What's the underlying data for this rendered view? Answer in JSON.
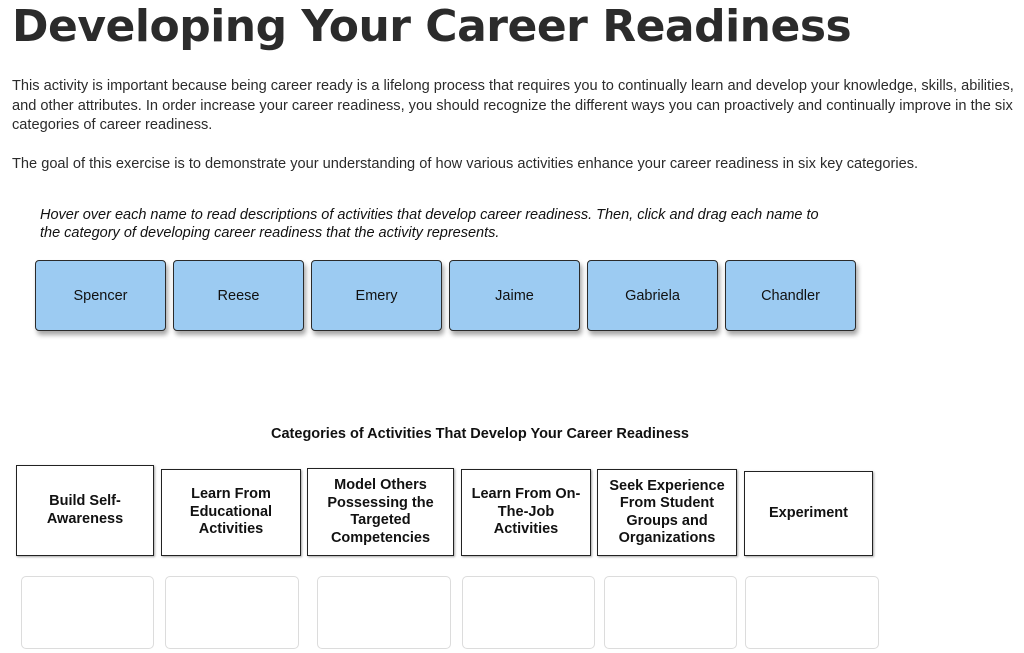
{
  "page": {
    "title": "Developing Your Career Readiness",
    "paragraphs": [
      "This activity is important because being career ready is a lifelong process that requires you to continually learn and develop your knowledge, skills, abilities, and other attributes. In order increase your career readiness, you should recognize the different ways you can proactively and continually improve in the six categories of career readiness.",
      "The goal of this exercise is to demonstrate your understanding of how various activities enhance your career readiness in six key categories."
    ],
    "instructions": "Hover over each name to read descriptions of activities that develop career readiness. Then, click and drag each name to the category of developing career readiness that the activity represents."
  },
  "names": [
    {
      "label": "Spencer"
    },
    {
      "label": "Reese"
    },
    {
      "label": "Emery"
    },
    {
      "label": "Jaime"
    },
    {
      "label": "Gabriela"
    },
    {
      "label": "Chandler"
    }
  ],
  "categories_heading": "Categories of Activities That Develop Your Career Readiness",
  "categories": [
    {
      "label": "Build Self-Awareness"
    },
    {
      "label": "Learn From Educational Activities"
    },
    {
      "label": "Model Others Possessing the Targeted Competencies"
    },
    {
      "label": "Learn From On-The-Job Activities"
    },
    {
      "label": "Seek Experience From Student Groups and Organizations"
    },
    {
      "label": "Experiment"
    }
  ],
  "colors": {
    "name_card_fill": "#9ccbf2",
    "text": "#2b2b2b",
    "drop_zone_border": "#dcdcdc"
  }
}
